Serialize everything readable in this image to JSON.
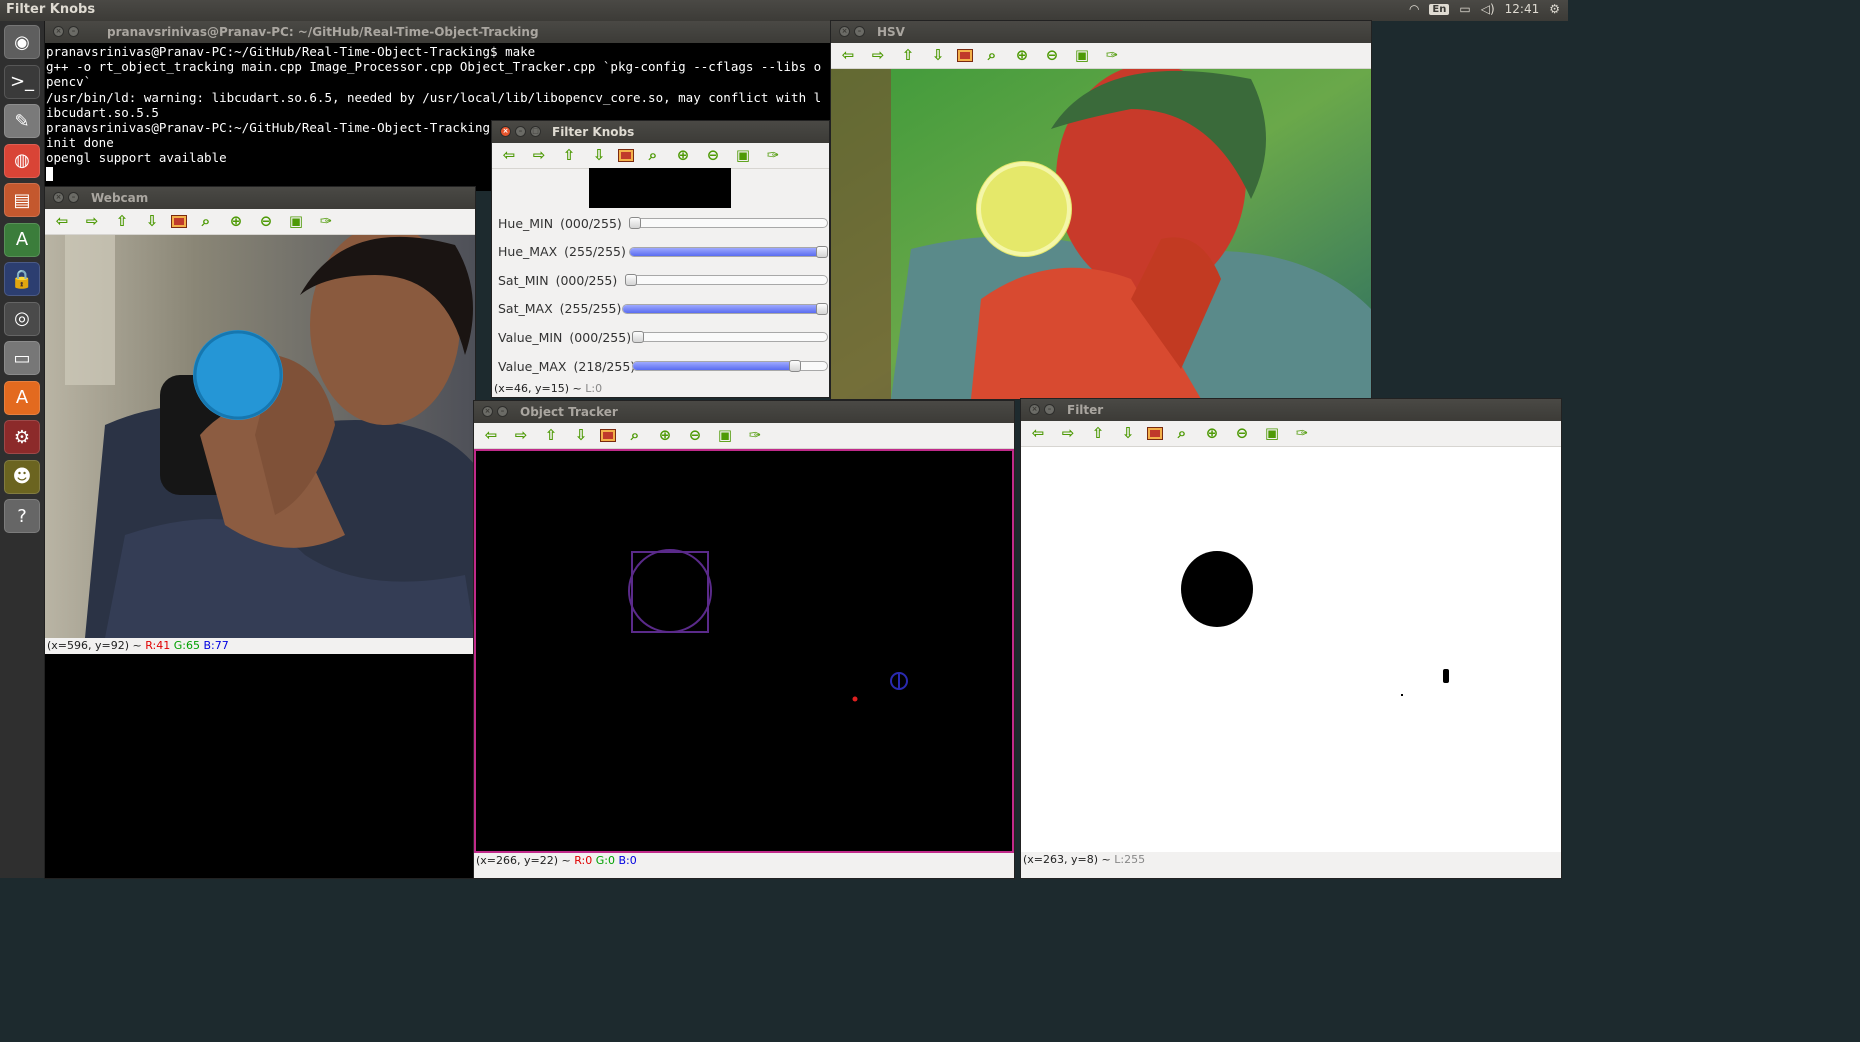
{
  "top_panel": {
    "app_title": "Filter Knobs",
    "kbd_layout": "En",
    "clock": "12:41"
  },
  "launcher": {
    "items": [
      {
        "name": "dash-home-icon",
        "glyph": "◉",
        "color": "#5e5e5e"
      },
      {
        "name": "terminal-icon",
        "glyph": ">_",
        "color": "#3a3a3a"
      },
      {
        "name": "text-editor-icon",
        "glyph": "✎",
        "color": "#7a7a7a"
      },
      {
        "name": "chrome-icon",
        "glyph": "◍",
        "color": "#d94436"
      },
      {
        "name": "file-manager-icon",
        "glyph": "▤",
        "color": "#c4582e"
      },
      {
        "name": "software-updater-icon",
        "glyph": "A",
        "color": "#3b7d3b"
      },
      {
        "name": "lock-icon",
        "glyph": "🔒",
        "color": "#2c3e70"
      },
      {
        "name": "webcam-icon",
        "glyph": "◎",
        "color": "#4a4a4a"
      },
      {
        "name": "drive-icon",
        "glyph": "▭",
        "color": "#777777"
      },
      {
        "name": "software-center-icon",
        "glyph": "A",
        "color": "#e36a1f"
      },
      {
        "name": "settings-icon",
        "glyph": "⚙",
        "color": "#8c2a2a"
      },
      {
        "name": "mario-icon",
        "glyph": "☻",
        "color": "#6b6420"
      },
      {
        "name": "help-icon",
        "glyph": "?",
        "color": "#666666"
      }
    ]
  },
  "terminal": {
    "title": "pranavsrinivas@Pranav-PC: ~/GitHub/Real-Time-Object-Tracking",
    "lines": [
      "pranavsrinivas@Pranav-PC:~/GitHub/Real-Time-Object-Tracking$ make",
      "g++ -o rt_object_tracking main.cpp Image_Processor.cpp Object_Tracker.cpp `pkg-config --cflags --libs o",
      "pencv`",
      "/usr/bin/ld: warning: libcudart.so.6.5, needed by /usr/local/lib/libopencv_core.so, may conflict with l",
      "ibcudart.so.5.5",
      "pranavsrinivas@Pranav-PC:~/GitHub/Real-Time-Object-Tracking",
      "init done",
      "opengl support available"
    ]
  },
  "webcam": {
    "title": "Webcam",
    "status": {
      "coords": "(x=596, y=92) ~ ",
      "r": "R:41",
      "g": "G:65",
      "b": "B:77"
    }
  },
  "hsv": {
    "title": "HSV"
  },
  "filter_knobs": {
    "title": "Filter Knobs",
    "status": {
      "coords": "(x=46, y=15) ~ ",
      "l": "L:0"
    },
    "sliders": [
      {
        "label": "Hue_MIN",
        "display": "(000/255)",
        "value": 0,
        "max": 255
      },
      {
        "label": "Hue_MAX",
        "display": "(255/255)",
        "value": 255,
        "max": 255
      },
      {
        "label": "Sat_MIN",
        "display": "(000/255)",
        "value": 0,
        "max": 255
      },
      {
        "label": "Sat_MAX",
        "display": "(255/255)",
        "value": 255,
        "max": 255
      },
      {
        "label": "Value_MIN",
        "display": "(000/255)",
        "value": 0,
        "max": 255
      },
      {
        "label": "Value_MAX",
        "display": "(218/255)",
        "value": 218,
        "max": 255
      }
    ]
  },
  "object_tracker": {
    "title": "Object Tracker",
    "status": {
      "coords": "(x=266, y=22) ~ ",
      "r": "R:0",
      "g": "G:0",
      "b": "B:0"
    }
  },
  "filter": {
    "title": "Filter",
    "status": {
      "coords": "(x=263, y=8) ~ ",
      "l": "L:255"
    }
  },
  "toolbar": {
    "icons": [
      {
        "name": "pan-left-icon",
        "glyph": "⇦"
      },
      {
        "name": "pan-right-icon",
        "glyph": "⇨"
      },
      {
        "name": "pan-up-icon",
        "glyph": "⇧"
      },
      {
        "name": "pan-down-icon",
        "glyph": "⇩"
      },
      {
        "name": "zoom-fit-icon",
        "glyph": ""
      },
      {
        "name": "zoom-original-icon",
        "glyph": "⌕"
      },
      {
        "name": "zoom-in-icon",
        "glyph": "⊕"
      },
      {
        "name": "zoom-out-icon",
        "glyph": "⊖"
      },
      {
        "name": "save-icon",
        "glyph": "▣"
      },
      {
        "name": "properties-icon",
        "glyph": "✑"
      }
    ]
  }
}
